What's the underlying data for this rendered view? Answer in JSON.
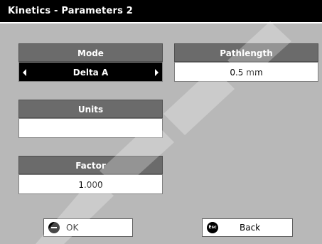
{
  "window": {
    "title": "Kinetics - Parameters 2"
  },
  "panels": {
    "mode": {
      "label": "Mode",
      "value": "Delta A"
    },
    "pathlength": {
      "label": "Pathlength",
      "value": "0.5 mm"
    },
    "units": {
      "label": "Units",
      "value": ""
    },
    "factor": {
      "label": "Factor",
      "value": "1.000"
    }
  },
  "buttons": {
    "ok": {
      "label": "OK",
      "icon": "ok-key-icon"
    },
    "back": {
      "label": "Back",
      "icon": "esc-key-icon",
      "icon_text": "Esc"
    }
  },
  "colors": {
    "background": "#b8b8b8",
    "titlebar": "#000000",
    "panel_header": "#6b6b6b",
    "selected_value": "#000000"
  }
}
